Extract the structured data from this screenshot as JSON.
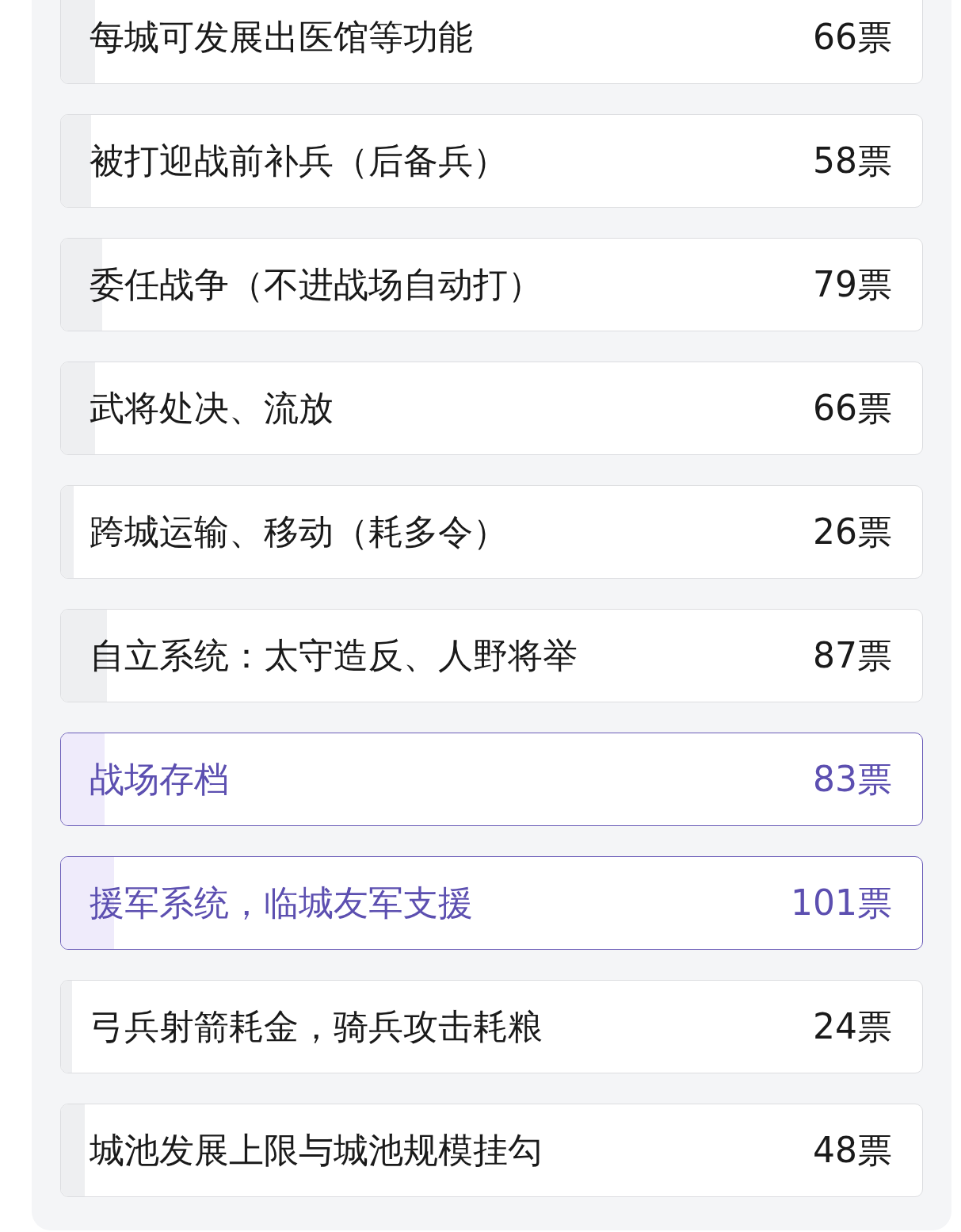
{
  "options": [
    {
      "label": "每城可发展出医馆等功能",
      "votes": "66票",
      "level": 0.04,
      "selected": false
    },
    {
      "label": "被打迎战前补兵（后备兵）",
      "votes": "58票",
      "level": 0.035,
      "selected": false
    },
    {
      "label": "委任战争（不进战场自动打）",
      "votes": "79票",
      "level": 0.048,
      "selected": false
    },
    {
      "label": "武将处决、流放",
      "votes": "66票",
      "level": 0.04,
      "selected": false
    },
    {
      "label": "跨城运输、移动（耗多令）",
      "votes": "26票",
      "level": 0.015,
      "selected": false
    },
    {
      "label": "自立系统：太守造反、人野将举",
      "votes": "87票",
      "level": 0.053,
      "selected": false
    },
    {
      "label": "战场存档",
      "votes": "83票",
      "level": 0.051,
      "selected": true
    },
    {
      "label": "援军系统，临城友军支援",
      "votes": "101票",
      "level": 0.062,
      "selected": true
    },
    {
      "label": "弓兵射箭耗金，骑兵攻击耗粮",
      "votes": "24票",
      "level": 0.013,
      "selected": false
    },
    {
      "label": "城池发展上限与城池规模挂勾",
      "votes": "48票",
      "level": 0.028,
      "selected": false
    }
  ]
}
